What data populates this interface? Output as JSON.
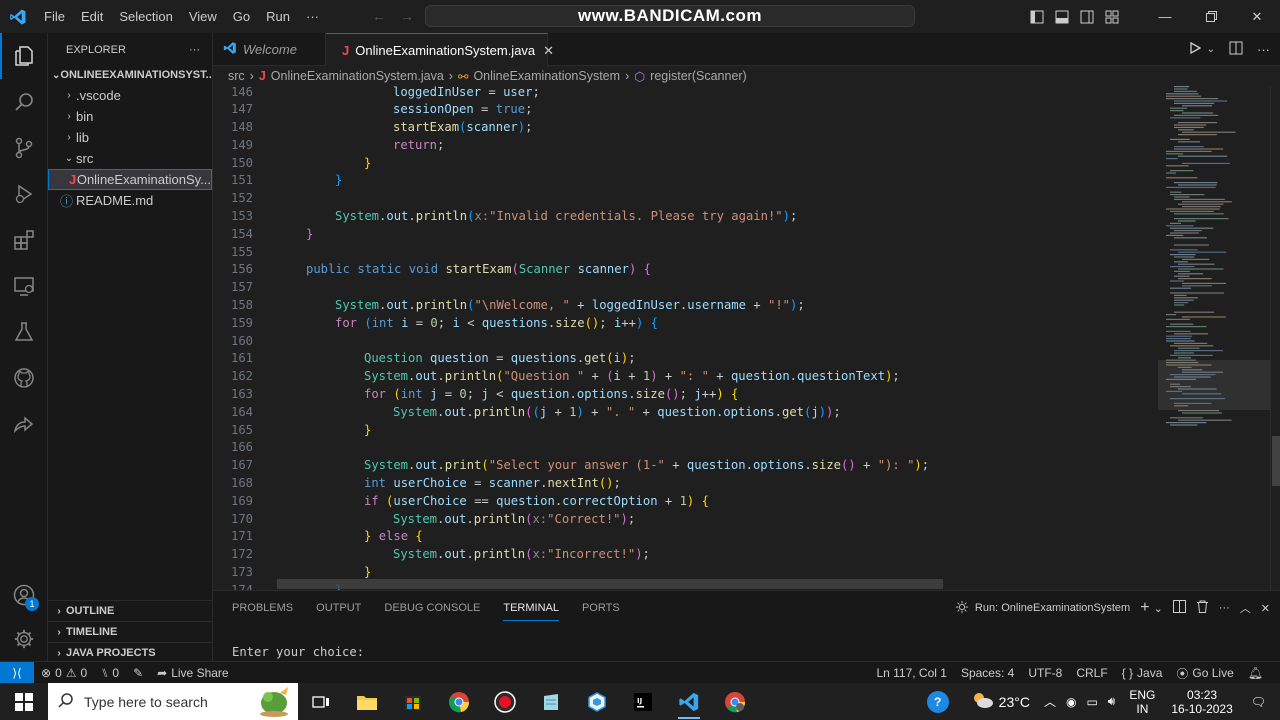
{
  "titlebar": {
    "menu": [
      "File",
      "Edit",
      "Selection",
      "View",
      "Go",
      "Run",
      "···"
    ],
    "command_center": "www.BANDICAM.com"
  },
  "sidebar": {
    "title": "EXPLORER",
    "more": "···",
    "root": "ONLINEEXAMINATIONSYST...",
    "items": [
      {
        "label": ".vscode"
      },
      {
        "label": "bin"
      },
      {
        "label": "lib"
      },
      {
        "label": "src"
      },
      {
        "label": "OnlineExaminationSy..."
      },
      {
        "label": "README.md"
      }
    ],
    "sections": [
      "OUTLINE",
      "TIMELINE",
      "JAVA PROJECTS"
    ]
  },
  "tabs": [
    {
      "label": "Welcome"
    },
    {
      "label": "OnlineExaminationSystem.java"
    }
  ],
  "breadcrumb": [
    "src",
    "OnlineExaminationSystem.java",
    "OnlineExaminationSystem",
    "register(Scanner)"
  ],
  "editor": {
    "line_numbers": [
      "146",
      "147",
      "148",
      "149",
      "150",
      "151",
      "152",
      "153",
      "154",
      "155",
      "156",
      "157",
      "158",
      "159",
      "160",
      "161",
      "162",
      "163",
      "164",
      "165",
      "166",
      "167",
      "168",
      "169",
      "170",
      "171",
      "172",
      "173",
      "174"
    ]
  },
  "panel": {
    "tabs": [
      "PROBLEMS",
      "OUTPUT",
      "DEBUG CONSOLE",
      "TERMINAL",
      "PORTS"
    ],
    "run_label": "Run: OnlineExaminationSystem",
    "terminal_text": "Enter your choice:"
  },
  "statusbar": {
    "errors": "0",
    "warnings": "0",
    "info": "0",
    "live_share": "Live Share",
    "position": "Ln 117, Col 1",
    "spaces": "Spaces: 4",
    "encoding": "UTF-8",
    "eol": "CRLF",
    "language": "Java",
    "go_live": "Go Live"
  },
  "taskbar": {
    "search_placeholder": "Type here to search",
    "temperature": "23°C",
    "lang_top": "ENG",
    "lang_bottom": "IN",
    "time": "03:23",
    "date": "16-10-2023"
  },
  "activity_badge": "1",
  "colors": {
    "accent": "#0078d4",
    "editor_bg": "#1f1f1f",
    "sidebar_bg": "#181818"
  }
}
